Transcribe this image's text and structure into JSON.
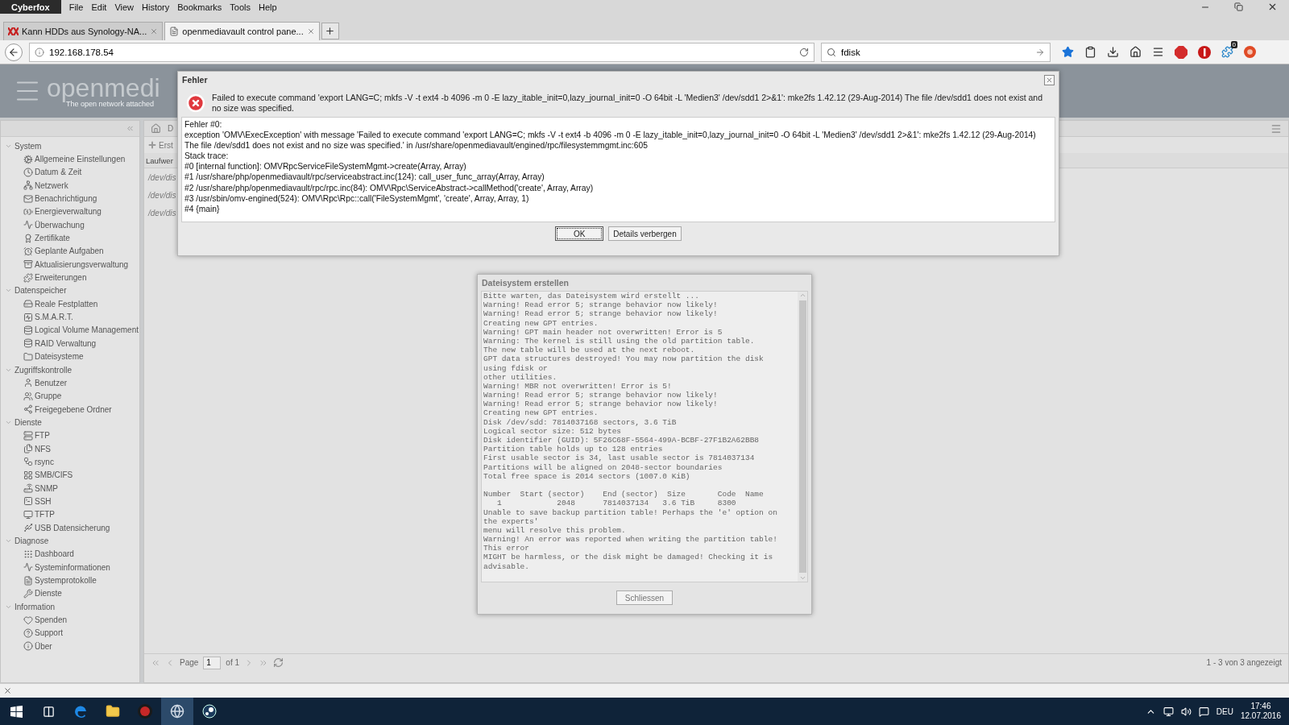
{
  "browser": {
    "app_menu": "Cyberfox",
    "menu": [
      "File",
      "Edit",
      "View",
      "History",
      "Bookmarks",
      "Tools",
      "Help"
    ],
    "tabs": [
      {
        "title": "Kann HDDs aus Synology-NA...",
        "selected": false
      },
      {
        "title": "openmediavault control pane...",
        "selected": true
      }
    ],
    "url": "192.168.178.54",
    "search": "fdisk",
    "badge": "0"
  },
  "header": {
    "logo": "openmedi",
    "tagline": "The open network attached"
  },
  "sidebar": {
    "groups": [
      {
        "label": "System",
        "expanded": true,
        "children": [
          {
            "label": "Allgemeine Einstellungen"
          },
          {
            "label": "Datum & Zeit"
          },
          {
            "label": "Netzwerk"
          },
          {
            "label": "Benachrichtigung"
          },
          {
            "label": "Energieverwaltung"
          },
          {
            "label": "Überwachung"
          },
          {
            "label": "Zertifikate"
          },
          {
            "label": "Geplante Aufgaben"
          },
          {
            "label": "Aktualisierungsverwaltung"
          },
          {
            "label": "Erweiterungen"
          }
        ]
      },
      {
        "label": "Datenspeicher",
        "expanded": true,
        "children": [
          {
            "label": "Reale Festplatten"
          },
          {
            "label": "S.M.A.R.T."
          },
          {
            "label": "Logical Volume Management"
          },
          {
            "label": "RAID Verwaltung"
          },
          {
            "label": "Dateisysteme"
          }
        ]
      },
      {
        "label": "Zugriffskontrolle",
        "expanded": true,
        "children": [
          {
            "label": "Benutzer"
          },
          {
            "label": "Gruppe"
          },
          {
            "label": "Freigegebene Ordner"
          }
        ]
      },
      {
        "label": "Dienste",
        "expanded": true,
        "children": [
          {
            "label": "FTP"
          },
          {
            "label": "NFS"
          },
          {
            "label": "rsync"
          },
          {
            "label": "SMB/CIFS"
          },
          {
            "label": "SNMP"
          },
          {
            "label": "SSH"
          },
          {
            "label": "TFTP"
          },
          {
            "label": "USB Datensicherung"
          }
        ]
      },
      {
        "label": "Diagnose",
        "expanded": true,
        "children": [
          {
            "label": "Dashboard"
          },
          {
            "label": "Systeminformationen"
          },
          {
            "label": "Systemprotokolle"
          },
          {
            "label": "Dienste"
          }
        ]
      },
      {
        "label": "Information",
        "expanded": true,
        "children": [
          {
            "label": "Spenden"
          },
          {
            "label": "Support"
          },
          {
            "label": "Über"
          }
        ]
      }
    ]
  },
  "main": {
    "breadcrumb": "D",
    "add_button": "Erst",
    "column": "Laufwer",
    "rows": [
      "/dev/dis",
      "/dev/dis",
      "/dev/dis"
    ]
  },
  "pager": {
    "page_label": "Page",
    "page": "1",
    "of": "of 1",
    "summary": "1 - 3 von 3 angezeigt"
  },
  "error_dialog": {
    "title": "Fehler",
    "message": "Failed to execute command 'export LANG=C; mkfs -V -t ext4 -b 4096 -m 0 -E lazy_itable_init=0,lazy_journal_init=0 -O 64bit -L 'Medien3' /dev/sdd1 2>&1': mke2fs 1.42.12 (29-Aug-2014) The file /dev/sdd1 does not exist and no size was specified.",
    "details": [
      "Fehler #0:",
      "exception 'OMV\\ExecException' with message 'Failed to execute command 'export LANG=C; mkfs -V -t ext4 -b 4096 -m 0 -E lazy_itable_init=0,lazy_journal_init=0 -O 64bit -L 'Medien3' /dev/sdd1 2>&1': mke2fs 1.42.12 (29-Aug-2014)",
      "The file /dev/sdd1 does not exist and no size was specified.' in /usr/share/openmediavault/engined/rpc/filesystemmgmt.inc:605",
      "Stack trace:",
      "#0 [internal function]: OMVRpcServiceFileSystemMgmt->create(Array, Array)",
      "#1 /usr/share/php/openmediavault/rpc/serviceabstract.inc(124): call_user_func_array(Array, Array)",
      "#2 /usr/share/php/openmediavault/rpc/rpc.inc(84): OMV\\Rpc\\ServiceAbstract->callMethod('create', Array, Array)",
      "#3 /usr/sbin/omv-engined(524): OMV\\Rpc\\Rpc::call('FileSystemMgmt', 'create', Array, Array, 1)",
      "#4 {main}"
    ],
    "buttons": [
      {
        "label": "OK",
        "selected": true
      },
      {
        "label": "Details verbergen",
        "selected": false
      }
    ]
  },
  "progress_dialog": {
    "title": "Dateisystem erstellen",
    "blocks": [
      [
        "Bitte warten, das Dateisystem wird erstellt ...",
        "Warning! Read error 5; strange behavior now likely!",
        "Warning! Read error 5; strange behavior now likely!",
        "Creating new GPT entries.",
        "Warning! GPT main header not overwritten! Error is 5",
        "Warning: The kernel is still using the old partition table.",
        "The new table will be used at the next reboot.",
        "GPT data structures destroyed! You may now partition the disk",
        "using fdisk or",
        "other utilities.",
        "Warning! MBR not overwritten! Error is 5!",
        "Warning! Read error 5; strange behavior now likely!",
        "Warning! Read error 5; strange behavior now likely!",
        "Creating new GPT entries.",
        "Disk /dev/sdd: 7814037168 sectors, 3.6 TiB",
        "Logical sector size: 512 bytes",
        "Disk identifier (GUID): 5F26C68F-5564-499A-BCBF-27F1B2A62BB8",
        "Partition table holds up to 128 entries",
        "First usable sector is 34, last usable sector is 7814037134",
        "Partitions will be aligned on 2048-sector boundaries",
        "Total free space is 2014 sectors (1007.0 KiB)"
      ],
      [
        "Number  Start (sector)    End (sector)  Size       Code  Name",
        "   1            2048      7814037134   3.6 TiB     8300",
        "Unable to save backup partition table! Perhaps the 'e' option on",
        "the experts'",
        "menu will resolve this problem.",
        "Warning! An error was reported when writing the partition table!",
        "This error",
        "MIGHT be harmless, or the disk might be damaged! Checking it is",
        "advisable."
      ]
    ],
    "button": "Schliessen"
  },
  "taskbar": {
    "language": "DEU",
    "time": "17:46",
    "date": "12.07.2016"
  }
}
